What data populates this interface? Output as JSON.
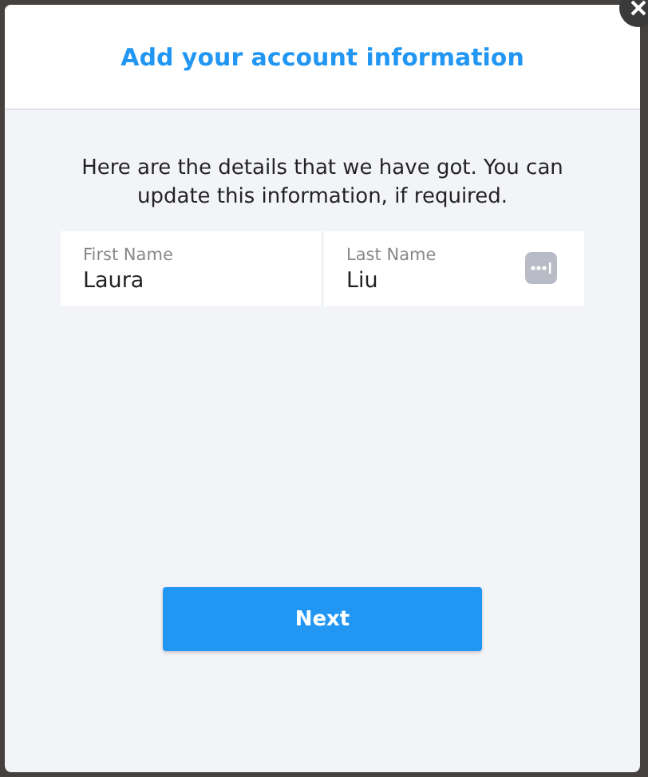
{
  "modal": {
    "title": "Add your account information"
  },
  "intro": "Here are the details that we have got. You can update this information, if required.",
  "fields": [
    {
      "label": "First Name",
      "value": "Laura",
      "autofill": false
    },
    {
      "label": "Last Name",
      "value": "Liu",
      "autofill": true
    }
  ],
  "buttons": [
    {
      "label": "Next"
    }
  ]
}
